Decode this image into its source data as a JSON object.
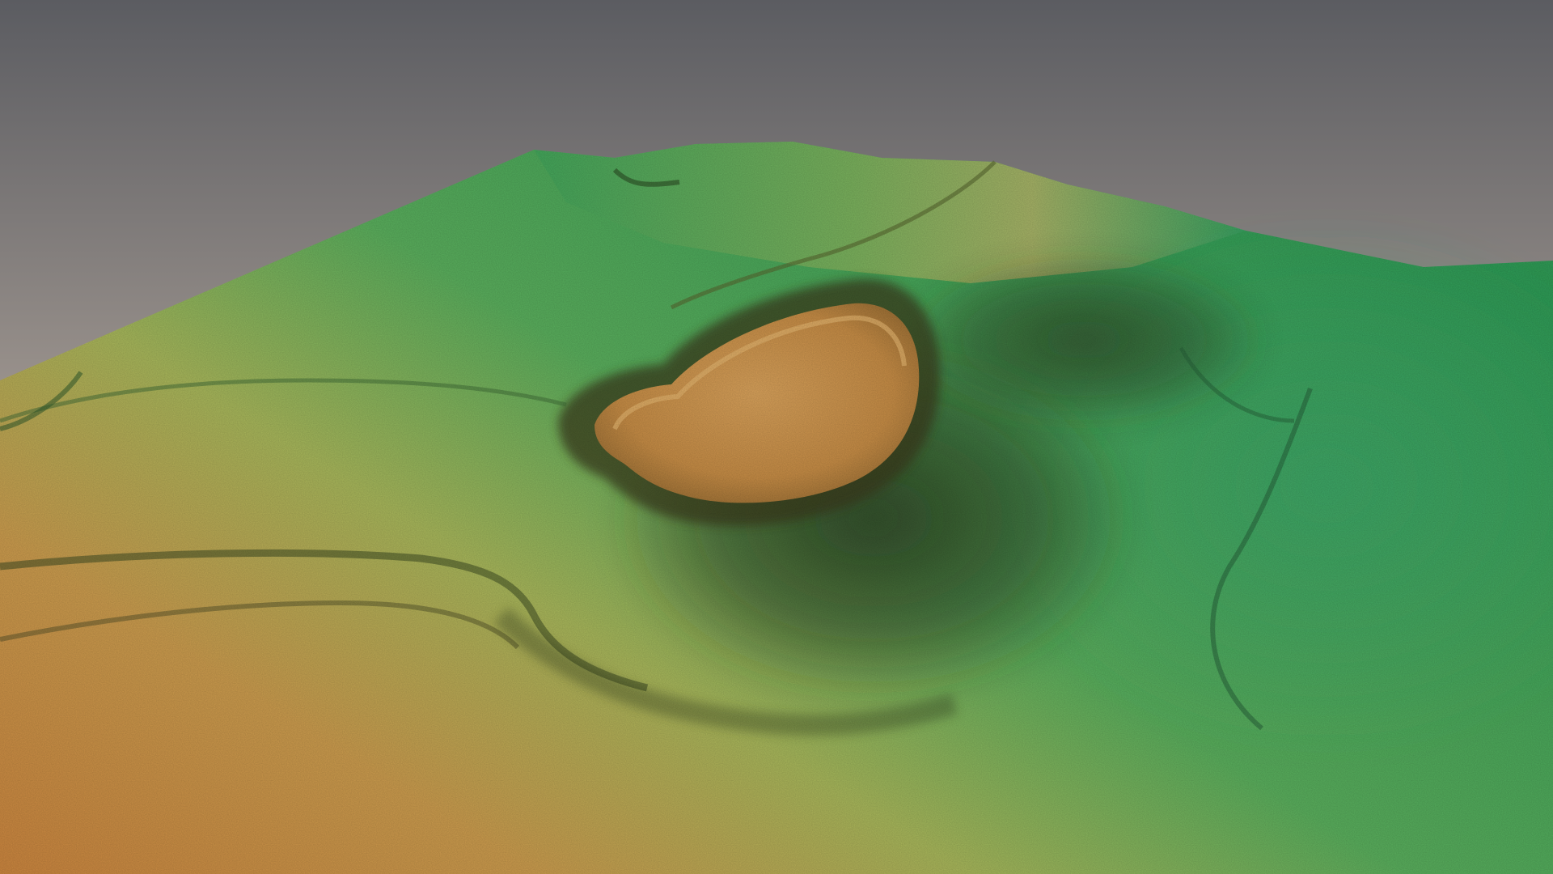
{
  "scene": {
    "subject": "terrain",
    "colors": {
      "sky_top": "#5b5c61",
      "sky_bottom": "#a89e96",
      "low_green": "#2f9a55",
      "mid_green": "#59ad5c",
      "yellow_green": "#a6b55a",
      "ochre": "#c99a4d",
      "orange": "#c9843e",
      "shadow": "#2b3a1f"
    }
  }
}
